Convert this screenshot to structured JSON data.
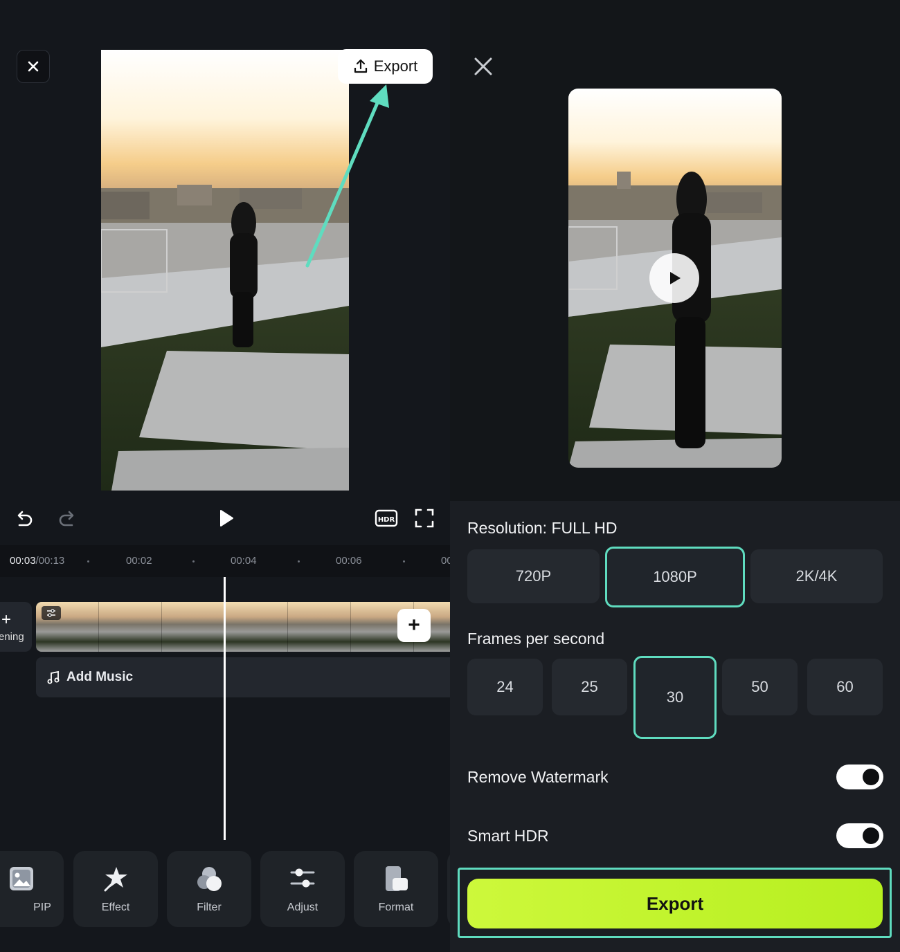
{
  "editor": {
    "export_label": "Export",
    "timeline": {
      "current_time": "00:03",
      "total_time": "/00:13",
      "ticks": [
        "00:02",
        "00:04",
        "00:06",
        "00"
      ]
    },
    "opening_label": "ening",
    "add_music_label": "Add Music",
    "tools": [
      {
        "label": "PIP",
        "icon": "pip-icon"
      },
      {
        "label": "Effect",
        "icon": "effect-star-icon"
      },
      {
        "label": "Filter",
        "icon": "filter-circles-icon"
      },
      {
        "label": "Adjust",
        "icon": "adjust-sliders-icon"
      },
      {
        "label": "Format",
        "icon": "format-icon"
      }
    ]
  },
  "export_panel": {
    "resolution_title": "Resolution: FULL HD",
    "resolutions": [
      {
        "label": "720P",
        "selected": false
      },
      {
        "label": "1080P",
        "selected": true
      },
      {
        "label": "2K/4K",
        "selected": false
      }
    ],
    "fps_title": "Frames per second",
    "fps_options": [
      {
        "label": "24",
        "selected": false
      },
      {
        "label": "25",
        "selected": false
      },
      {
        "label": "30",
        "selected": true
      },
      {
        "label": "50",
        "selected": false
      },
      {
        "label": "60",
        "selected": false
      }
    ],
    "remove_watermark_label": "Remove Watermark",
    "remove_watermark_on": true,
    "smart_hdr_label": "Smart HDR",
    "smart_hdr_on": true,
    "export_button_label": "Export"
  },
  "colors": {
    "accent_teal": "#5fdcbf",
    "export_green": "#c3f42f",
    "background": "#14171c"
  }
}
